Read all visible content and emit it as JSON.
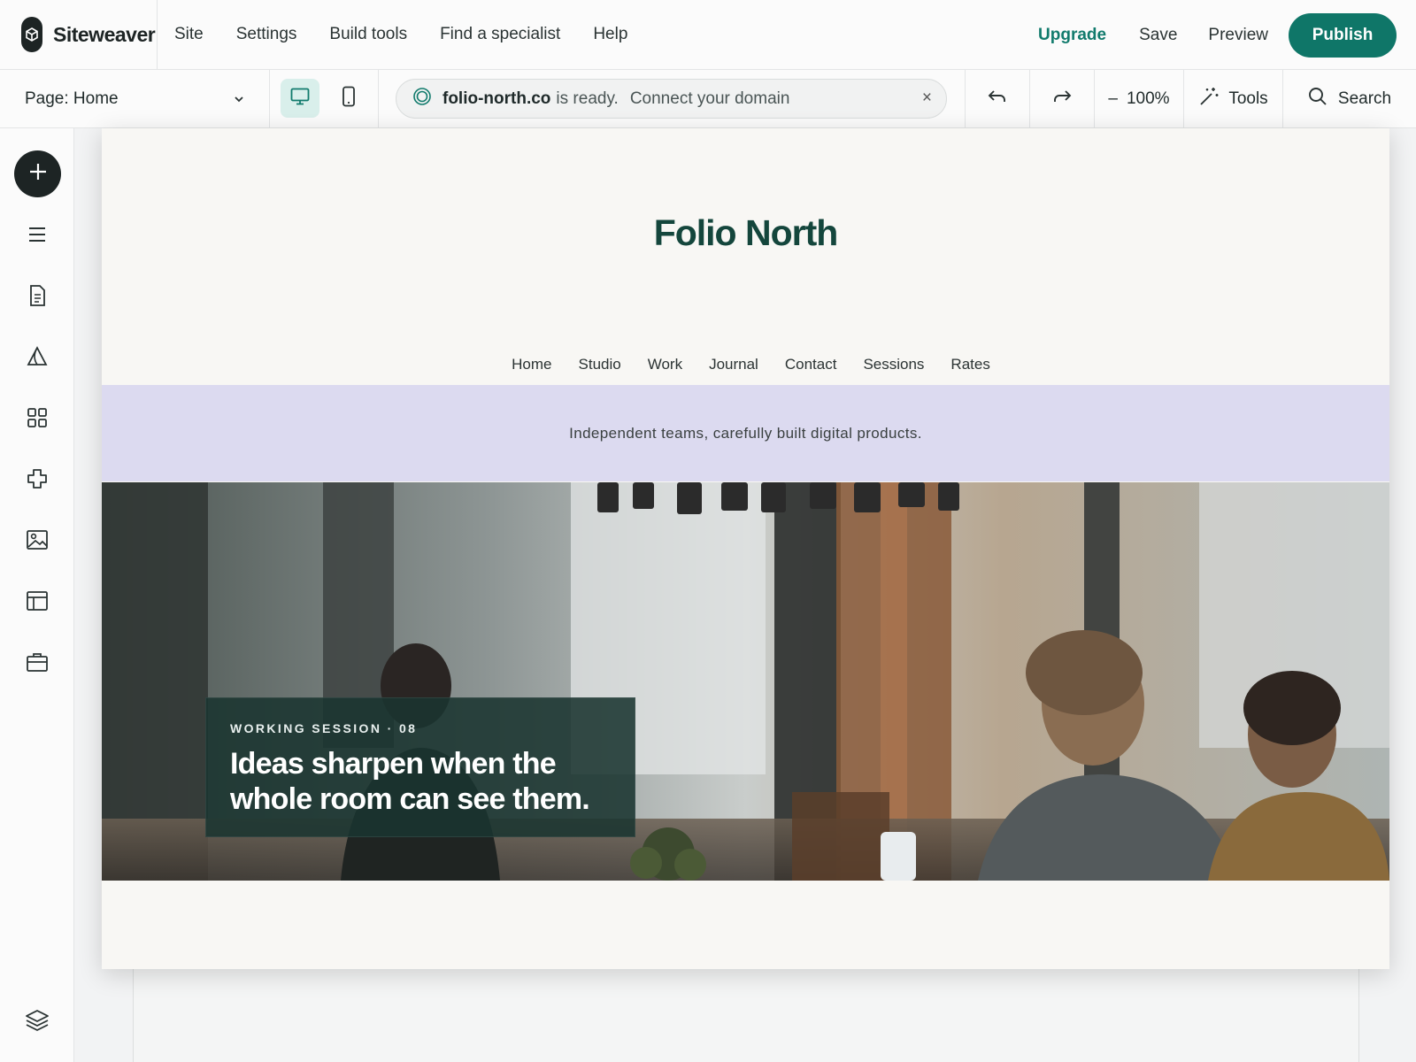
{
  "app": {
    "name": "Siteweaver",
    "nav": [
      "Site",
      "Settings",
      "Build tools",
      "Find a specialist",
      "Help"
    ],
    "actions": {
      "upgrade": "Upgrade",
      "save": "Save",
      "preview": "Preview",
      "publish": "Publish"
    },
    "accent_color": "#0f7668"
  },
  "toolbar": {
    "page_selector": "Page: Home",
    "notice": {
      "domain": "folio-north.co",
      "status": "is ready.",
      "link": "Connect your domain",
      "close": "×"
    },
    "zoom": {
      "minus": "–",
      "value": "100%"
    },
    "tools_label": "Tools",
    "search_label": "Search"
  },
  "rail": {
    "icons": [
      "plus-icon",
      "menu-icon",
      "page-icon",
      "design-icon",
      "apps-icon",
      "plugin-icon",
      "image-icon",
      "table-icon",
      "briefcase-icon",
      "layers-icon"
    ]
  },
  "site": {
    "title": "Folio North",
    "nav": [
      "Home",
      "Studio",
      "Work",
      "Journal",
      "Contact",
      "Sessions",
      "Rates"
    ],
    "tagline": "Independent teams, carefully built digital products.",
    "tagline_bg": "#dcdaf0",
    "hero": {
      "kicker": "WORKING SESSION · 08",
      "headline": "Ideas sharpen when the whole room can see them."
    }
  }
}
